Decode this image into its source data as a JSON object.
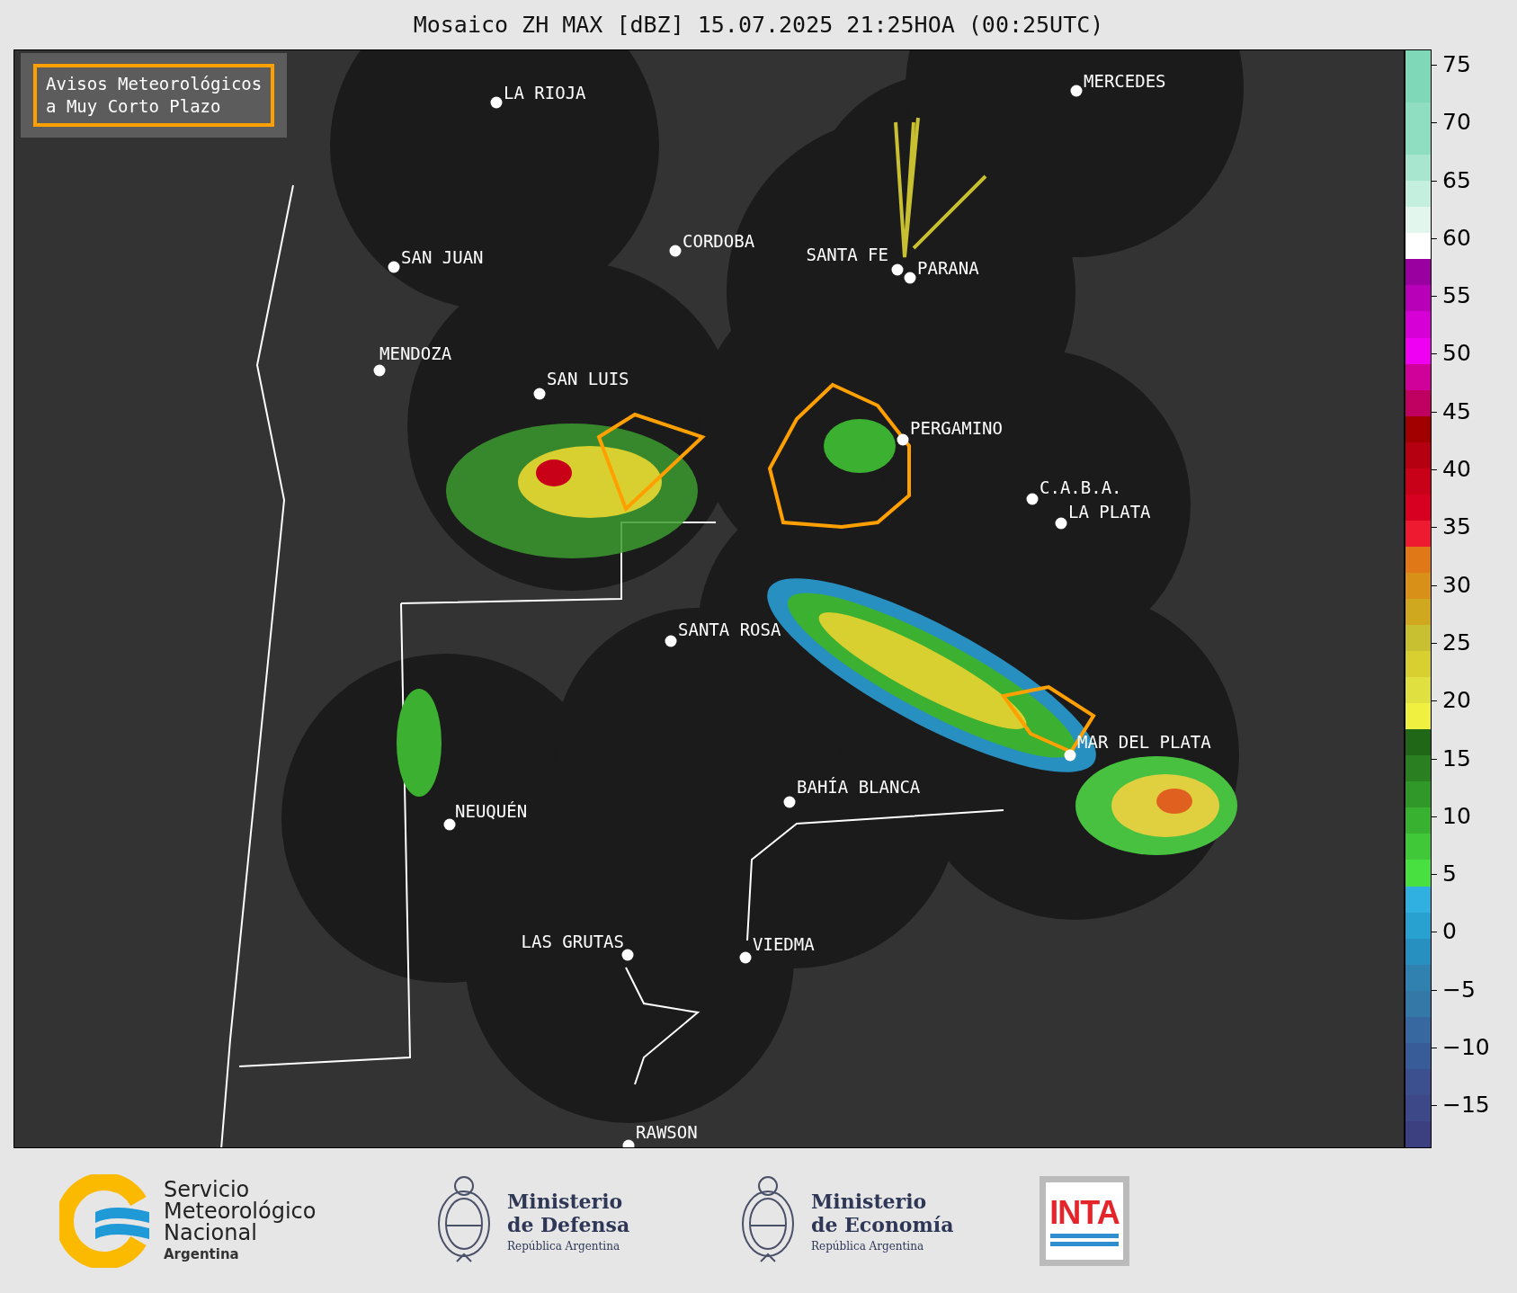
{
  "title": "Mosaico ZH MAX [dBZ] 15.07.2025 21:25HOA (00:25UTC)",
  "legend_box": {
    "lines": [
      "Avisos Meteorológicos",
      "a Muy Corto Plazo"
    ]
  },
  "cities": [
    {
      "name": "LA RIOJA"
    },
    {
      "name": "MERCEDES"
    },
    {
      "name": "SAN JUAN"
    },
    {
      "name": "CORDOBA"
    },
    {
      "name": "SANTA FE"
    },
    {
      "name": "PARANA"
    },
    {
      "name": "MENDOZA"
    },
    {
      "name": "SAN LUIS"
    },
    {
      "name": "PERGAMINO"
    },
    {
      "name": "C.A.B.A."
    },
    {
      "name": "LA PLATA"
    },
    {
      "name": "SANTA ROSA"
    },
    {
      "name": "MAR DEL PLATA"
    },
    {
      "name": "BAHÍA BLANCA"
    },
    {
      "name": "NEUQUÉN"
    },
    {
      "name": "LAS GRUTAS"
    },
    {
      "name": "VIEDMA"
    },
    {
      "name": "RAWSON"
    }
  ],
  "colorbar": {
    "ticks": [
      "75",
      "70",
      "65",
      "60",
      "55",
      "50",
      "45",
      "40",
      "35",
      "30",
      "25",
      "20",
      "15",
      "10",
      "5",
      "0",
      "−5",
      "−10",
      "−15"
    ]
  },
  "logos": [
    {
      "kind": "smn",
      "lines": [
        "Servicio",
        "Meteorológico",
        "Nacional"
      ],
      "subtitle": "Argentina"
    },
    {
      "kind": "ministry",
      "lines": [
        "Ministerio",
        "de Defensa"
      ],
      "subtitle": "República Argentina"
    },
    {
      "kind": "ministry",
      "lines": [
        "Ministerio",
        "de Economía"
      ],
      "subtitle": "República Argentina"
    },
    {
      "kind": "inta",
      "text": "INTA"
    }
  ]
}
